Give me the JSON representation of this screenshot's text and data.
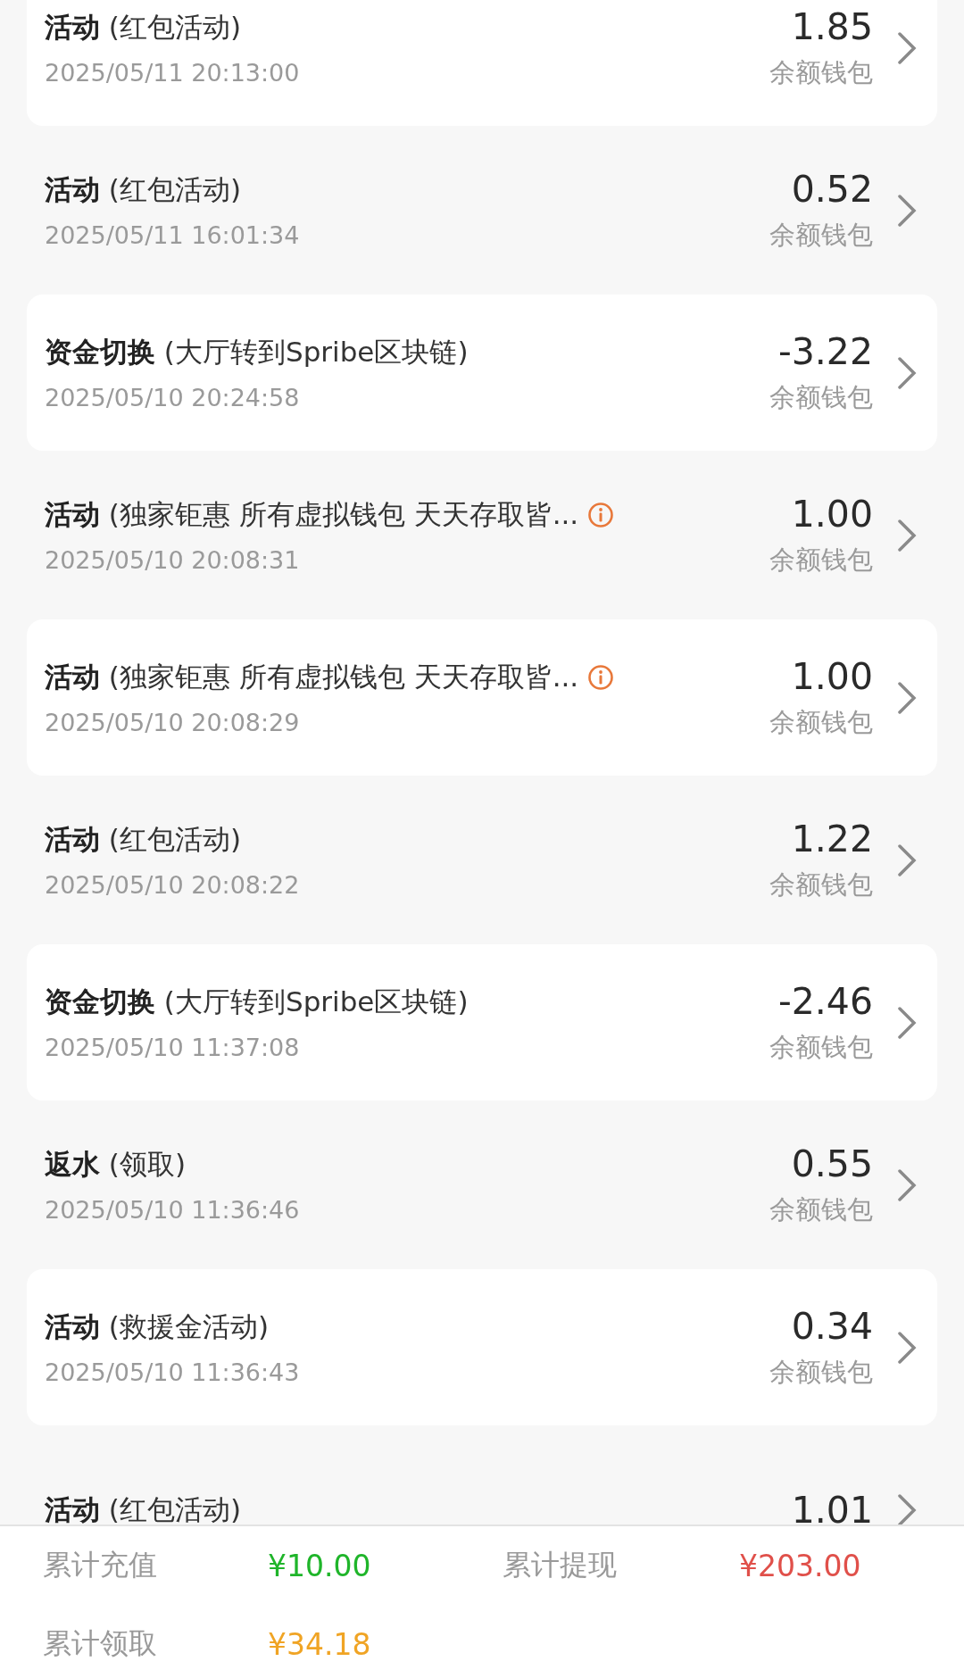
{
  "records": [
    {
      "title": "**活动** (红包活动)",
      "time": "2025/05/11 20:13:00",
      "amount": "1.85",
      "wallet": "余额钱包",
      "info": false
    },
    {
      "title": "**活动** (红包活动)",
      "time": "2025/05/11 16:01:34",
      "amount": "0.52",
      "wallet": "余额钱包",
      "info": false
    },
    {
      "title": "**资金切换** (大厅转到Spribe区块链)",
      "time": "2025/05/10 20:24:58",
      "amount": "-3.22",
      "wallet": "余额钱包",
      "info": false
    },
    {
      "title": "**活动** (独家钜惠 所有虚拟钱包 天天存取皆...",
      "time": "2025/05/10 20:08:31",
      "amount": "1.00",
      "wallet": "余额钱包",
      "info": true
    },
    {
      "title": "**活动** (独家钜惠 所有虚拟钱包 天天存取皆...",
      "time": "2025/05/10 20:08:29",
      "amount": "1.00",
      "wallet": "余额钱包",
      "info": true
    },
    {
      "title": "**活动** (红包活动)",
      "time": "2025/05/10 20:08:22",
      "amount": "1.22",
      "wallet": "余额钱包",
      "info": false
    },
    {
      "title": "**资金切换** (大厅转到Spribe区块链)",
      "time": "2025/05/10 11:37:08",
      "amount": "-2.46",
      "wallet": "余额钱包",
      "info": false
    },
    {
      "title": "**返水** (领取)",
      "time": "2025/05/10 11:36:46",
      "amount": "0.55",
      "wallet": "余额钱包",
      "info": false
    },
    {
      "title": "**活动** (救援金活动)",
      "time": "2025/05/10 11:36:43",
      "amount": "0.34",
      "wallet": "余额钱包",
      "info": false
    },
    {
      "title": "**活动** (红包活动)",
      "amount": "1.01",
      "info": false
    }
  ],
  "summary": [
    {
      "label": "累计充值",
      "value": "¥10.00",
      "color": "#1fb52a"
    },
    {
      "label": "累计提现",
      "value": "¥203.00",
      "color": "#e0504a"
    },
    {
      "label": "累计领取",
      "value": "¥34.18",
      "color": "#f0a424"
    }
  ]
}
